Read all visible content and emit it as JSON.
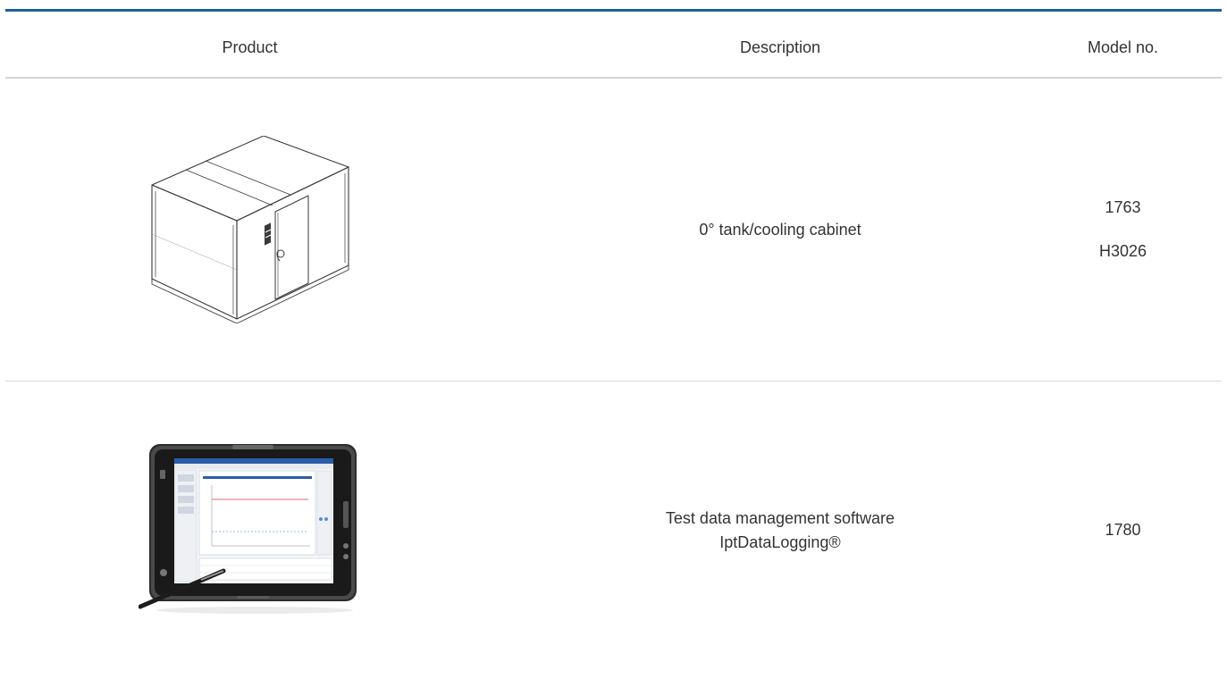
{
  "table": {
    "headers": {
      "product": "Product",
      "description": "Description",
      "model": "Model no."
    },
    "rows": [
      {
        "image": "cooling-cabinet-illustration",
        "description_lines": [
          "0° tank/cooling cabinet"
        ],
        "model_numbers": [
          "1763",
          "H3026"
        ]
      },
      {
        "image": "tablet-with-stylus-photo",
        "description_lines": [
          "Test data management software",
          "IptDataLogging®"
        ],
        "model_numbers": [
          "1780"
        ]
      }
    ]
  },
  "colors": {
    "accent_rule": "#1f5f99",
    "divider": "#d4d4d4",
    "text": "#333333"
  }
}
